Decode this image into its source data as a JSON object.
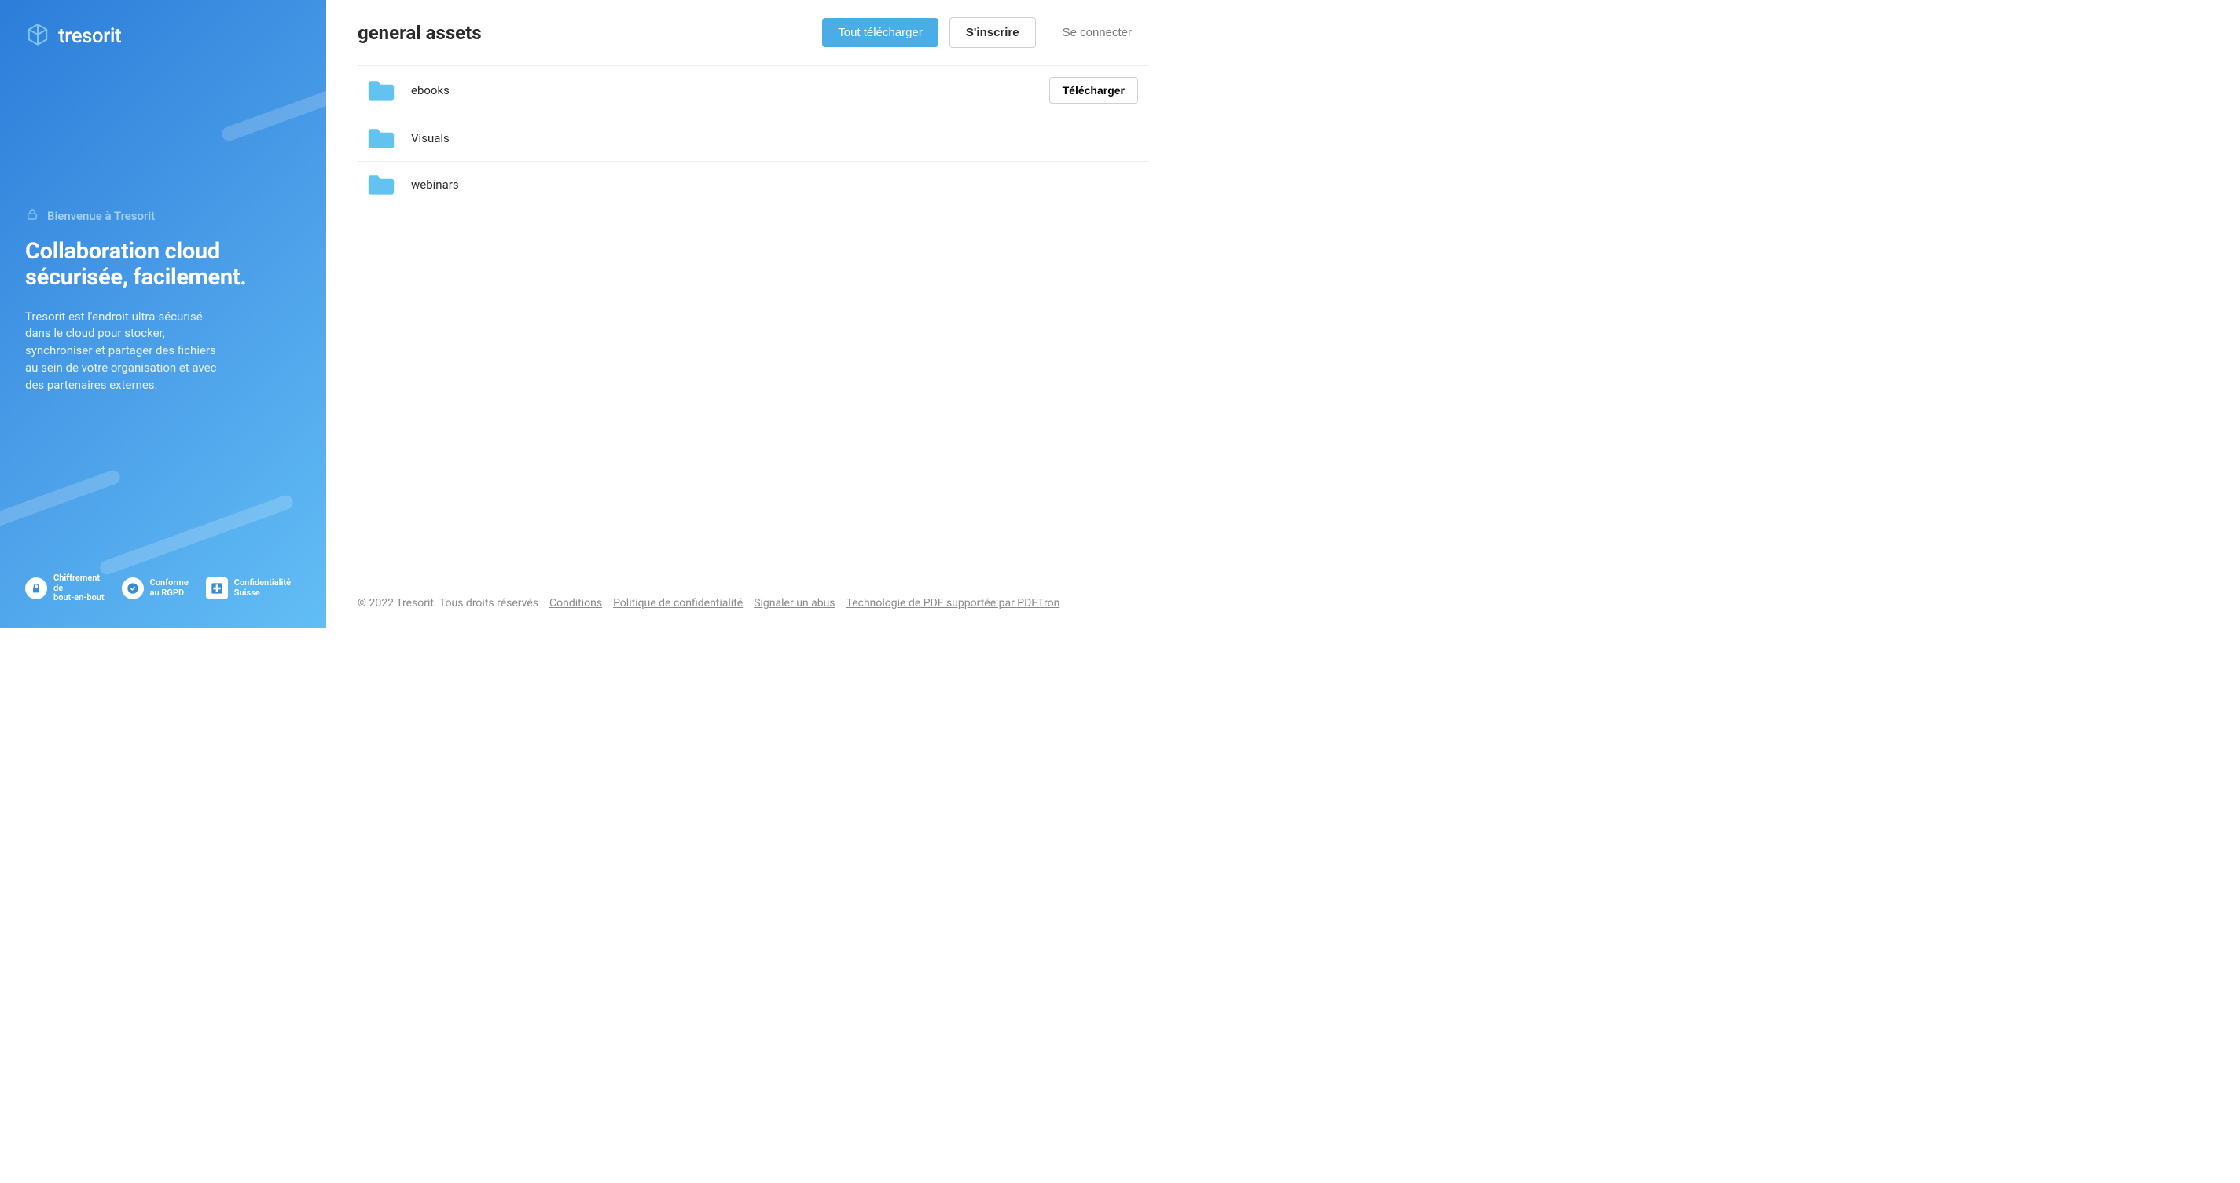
{
  "brand": {
    "name": "tresorit"
  },
  "sidebar": {
    "welcome_label": "Bienvenue à Tresorit",
    "headline": "Collaboration cloud sécurisée, facilement.",
    "subtext": "Tresorit est l'endroit ultra-sécurisé dans le cloud pour stocker, synchroniser et partager des fichiers au sein de votre organisation et avec des partenaires externes.",
    "badges": [
      {
        "id": "e2ee",
        "line1": "Chiffrement",
        "line2": "de",
        "line3": "bout-en-bout"
      },
      {
        "id": "gdpr",
        "line1": "Conforme",
        "line2": "au RGPD"
      },
      {
        "id": "swiss",
        "line1": "Confidentialité",
        "line2": "Suisse"
      }
    ]
  },
  "header": {
    "title": "general assets",
    "download_all": "Tout télécharger",
    "signup": "S'inscrire",
    "login": "Se connecter"
  },
  "files": [
    {
      "name": "ebooks",
      "action": "Télécharger"
    },
    {
      "name": "Visuals"
    },
    {
      "name": "webinars"
    }
  ],
  "footer": {
    "copyright": "© 2022 Tresorit. Tous droits réservés",
    "links": [
      "Conditions",
      "Politique de confidentialité",
      "Signaler un abus",
      "Technologie de PDF supportée par PDFTron"
    ]
  }
}
